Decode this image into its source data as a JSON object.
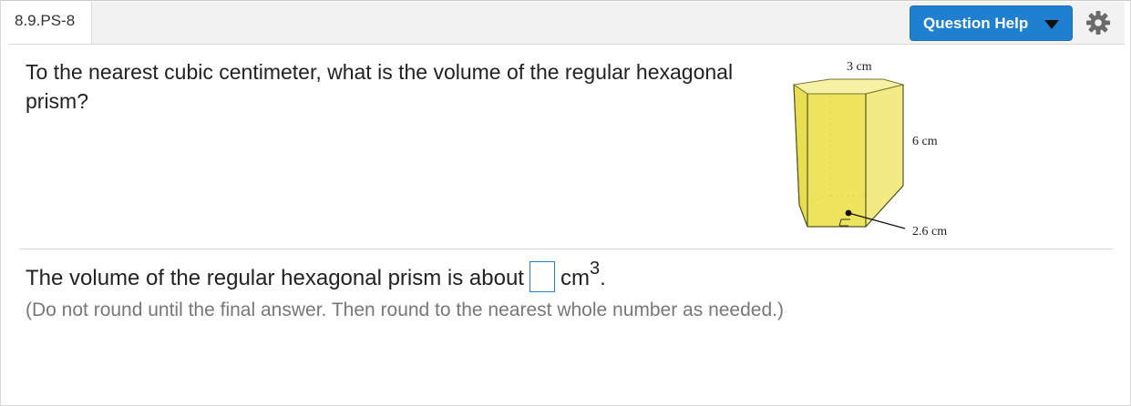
{
  "header": {
    "question_id": "8.9.PS-8",
    "help_button_label": "Question Help"
  },
  "icons": {
    "help_dropdown": "caret-down-icon",
    "settings": "gear-icon"
  },
  "question": {
    "text": "To the nearest cubic centimeter, what is the volume of the regular hexagonal prism?"
  },
  "figure": {
    "side_label": "3 cm",
    "height_label": "6 cm",
    "apothem_label": "2.6 cm"
  },
  "answer": {
    "prefix": "The volume of the regular hexagonal prism is about",
    "value": "",
    "unit": "cm",
    "unit_exponent": "3",
    "suffix": "."
  },
  "hint": {
    "text": "(Do not round until the final answer. Then round to the nearest whole number as needed.)"
  },
  "colors": {
    "accent": "#1f7fd1",
    "prism_fill": "#ede24e"
  }
}
